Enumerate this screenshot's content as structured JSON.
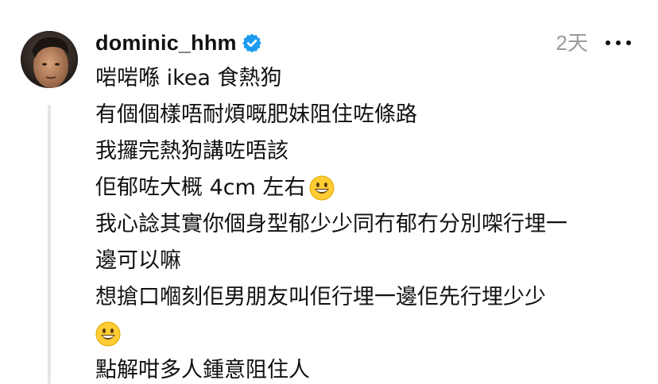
{
  "post": {
    "username": "dominic_hhm",
    "verified_icon": "verified-badge-icon",
    "time": "2天",
    "more_icon": "more-horizontal-icon",
    "lines": [
      "啱啱喺 ikea 食熱狗",
      "有個個樣唔耐煩嘅肥妹阻住咗條路",
      "我攞完熱狗講咗唔該",
      "佢郁咗大概 4cm 左右",
      "我心諗其實你個身型郁少少同冇郁冇分別㗎行埋一",
      "邊可以嘛",
      "想搶口嗰刻佢男朋友叫佢行埋一邊佢先行埋少少",
      "",
      "點解咁多人鍾意阻住人"
    ],
    "emoji_icon": "grinning-face-emoji-icon",
    "colors": {
      "verified": "#1d9bf0",
      "time": "#9a9a9a",
      "thread_line": "#e6e6e6"
    }
  }
}
